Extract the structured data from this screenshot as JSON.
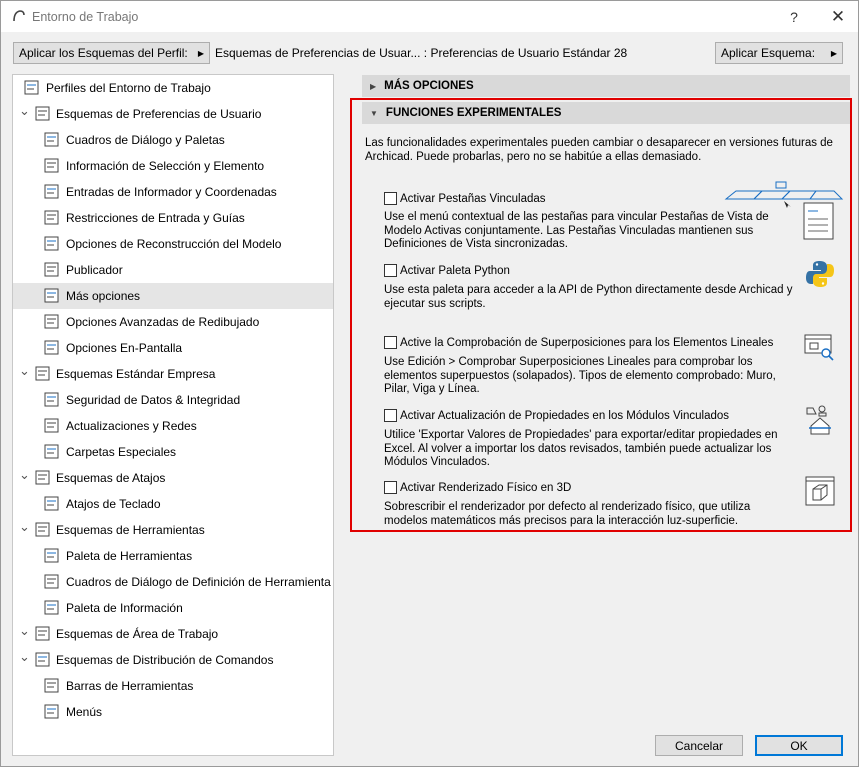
{
  "window": {
    "title": "Entorno de Trabajo",
    "help_label": "?",
    "close_label": "✕"
  },
  "toolbar": {
    "apply_profile_label": "Aplicar los Esquemas del Perfil:",
    "breadcrumb": "Esquemas de Preferencias de Usuar... :  Preferencias de Usuario Estándar 28",
    "apply_scheme_label": "Aplicar Esquema:"
  },
  "sidebar": {
    "items": [
      {
        "label": "Perfiles del Entorno de Trabajo",
        "icon": "profile-icon"
      },
      {
        "label": "Esquemas de Preferencias de Usuario",
        "icon": "user-preferences-icon"
      },
      {
        "label": "Cuadros de Diálogo y Paletas",
        "icon": "dialogs-icon"
      },
      {
        "label": "Información de Selección y Elemento",
        "icon": "selection-info-icon"
      },
      {
        "label": "Entradas de Informador y Coordenadas",
        "icon": "xyz-icon"
      },
      {
        "label": "Restricciones de Entrada y Guías",
        "icon": "mouse-constraints-icon"
      },
      {
        "label": "Opciones de Reconstrucción del Modelo",
        "icon": "rebuild-icon"
      },
      {
        "label": "Publicador",
        "icon": "publisher-icon"
      },
      {
        "label": "Más opciones",
        "icon": "sliders-icon"
      },
      {
        "label": "Opciones Avanzadas de Redibujado",
        "icon": "redraw-icon"
      },
      {
        "label": "Opciones En-Pantalla",
        "icon": "monitor-icon"
      },
      {
        "label": "Esquemas Estándar Empresa",
        "icon": "company-icon"
      },
      {
        "label": "Seguridad de Datos & Integridad",
        "icon": "gear-icon"
      },
      {
        "label": "Actualizaciones y Redes",
        "icon": "globe-icon"
      },
      {
        "label": "Carpetas Especiales",
        "icon": "folder-icon"
      },
      {
        "label": "Esquemas de Atajos",
        "icon": "shortcut-scheme-icon"
      },
      {
        "label": "Atajos de Teclado",
        "icon": "keyboard-shortcut-icon"
      },
      {
        "label": "Esquemas de Herramientas",
        "icon": "tool-scheme-icon"
      },
      {
        "label": "Paleta de Herramientas",
        "icon": "toolbox-icon"
      },
      {
        "label": "Cuadros de Diálogo de Definición de Herramienta",
        "icon": "tool-settings-icon"
      },
      {
        "label": "Paleta de Información",
        "icon": "info-box-icon"
      },
      {
        "label": "Esquemas de Área de Trabajo",
        "icon": "workspace-icon"
      },
      {
        "label": "Esquemas de Distribución de Comandos",
        "icon": "command-layout-icon"
      },
      {
        "label": "Barras de Herramientas",
        "icon": "toolbars-icon"
      },
      {
        "label": "Menús",
        "icon": "menus-icon"
      }
    ]
  },
  "main": {
    "more_options_label": "MÁS OPCIONES",
    "experimental_label": "FUNCIONES EXPERIMENTALES",
    "intro": "Las funcionalidades experimentales pueden cambiar o desaparecer en versiones futuras de Archicad. Puede probarlas, pero no se habitúe a ellas demasiado.",
    "options": [
      {
        "label": "Activar Pestañas Vinculadas",
        "checked": false,
        "desc": "Use el menú contextual de las pestañas para vincular Pestañas de Vista de Modelo Activas conjuntamente. Las Pestañas Vinculadas mantienen sus Definiciones de Vista sincronizadas."
      },
      {
        "label": "Activar Paleta Python",
        "checked": false,
        "desc": "Use esta paleta para acceder a la API de Python directamente desde Archicad y ejecutar sus scripts."
      },
      {
        "label": "Active la Comprobación de Superposiciones para los Elementos Lineales",
        "checked": false,
        "desc": "Use Edición > Comprobar Superposiciones Lineales para comprobar los elementos superpuestos (solapados). Tipos de elemento comprobado: Muro, Pilar, Viga y Línea."
      },
      {
        "label": "Activar Actualización de Propiedades en los Módulos Vinculados",
        "checked": false,
        "desc": "Utilice 'Exportar Valores de Propiedades' para exportar/editar propiedades en Excel. Al volver a importar los datos revisados, también puede actualizar los Módulos Vinculados."
      },
      {
        "label": "Activar Renderizado Físico en 3D",
        "checked": false,
        "desc": "Sobrescribir el renderizador por defecto al renderizado físico, que utiliza modelos matemáticos más precisos para la interacción luz-superficie."
      }
    ]
  },
  "footer": {
    "cancel_label": "Cancelar",
    "ok_label": "OK"
  },
  "colors": {
    "highlight_border": "#e00000",
    "selected_row": "#e5e5e5",
    "ok_border": "#0078d7"
  }
}
